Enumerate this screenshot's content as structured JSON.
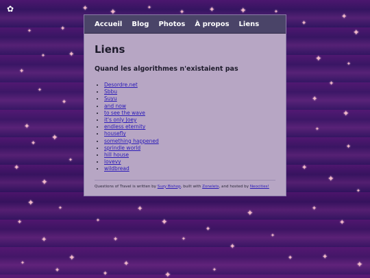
{
  "corner_icon": "plant-icon",
  "nav": {
    "items": [
      {
        "label": "Accueil"
      },
      {
        "label": "Blog"
      },
      {
        "label": "Photos"
      },
      {
        "label": "À propos"
      },
      {
        "label": "Liens"
      }
    ]
  },
  "main": {
    "title": "Liens",
    "section_title": "Quand les algorithmes n'existaient pas",
    "links": [
      "Desordre.net",
      "Sbbu",
      "Suyu",
      "and now",
      "to see the wave",
      "it's only Joey",
      "endless eternity",
      "housefly",
      "something happened",
      "sprindle world",
      "hill house",
      "lovevy",
      "wildbread"
    ]
  },
  "footer": {
    "text_1": "Questions of Travel is written by ",
    "author": "Suzy Bishop",
    "text_2": ", built with ",
    "builder": "Zonelets",
    "text_3": ", and hosted by ",
    "host": "Neocities!"
  },
  "colors": {
    "nav_bg": "#4a4468",
    "panel_bg": "#b7a6c4",
    "link": "#2a1ab8",
    "background": "#3a1a6e",
    "star": "#f2b8c8"
  }
}
